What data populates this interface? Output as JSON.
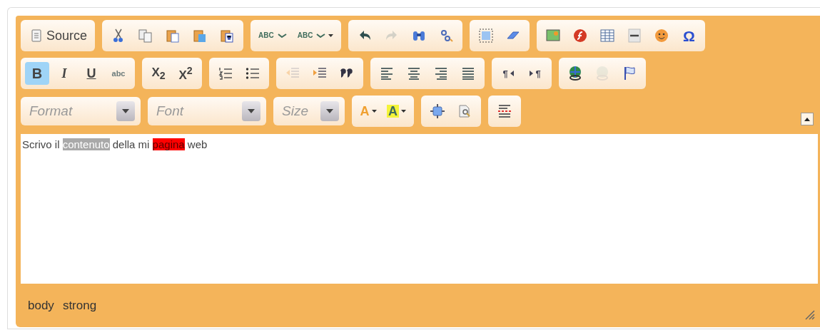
{
  "toolbar": {
    "rows": [
      {
        "combos": [],
        "groups": [
          [
            {
              "kind": "source",
              "label": "Source",
              "selected": false,
              "disabled": false
            }
          ],
          [
            {
              "kind": "cut",
              "selected": false,
              "disabled": false
            },
            {
              "kind": "copy",
              "selected": false,
              "disabled": false
            },
            {
              "kind": "paste",
              "selected": false,
              "disabled": false
            },
            {
              "kind": "pastetext",
              "selected": false,
              "disabled": false
            },
            {
              "kind": "pasteword",
              "selected": false,
              "disabled": false
            }
          ],
          [
            {
              "kind": "spell",
              "label": "ABC",
              "selected": false,
              "disabled": false
            },
            {
              "kind": "spellmenu",
              "label": "ABC",
              "selected": false,
              "disabled": false
            }
          ],
          [
            {
              "kind": "undo",
              "selected": false,
              "disabled": false
            },
            {
              "kind": "redo",
              "selected": false,
              "disabled": true
            },
            {
              "kind": "find",
              "selected": false,
              "disabled": false
            },
            {
              "kind": "replace",
              "selected": false,
              "disabled": false
            }
          ],
          [
            {
              "kind": "selectall",
              "selected": false,
              "disabled": false
            },
            {
              "kind": "eraser",
              "selected": false,
              "disabled": false
            }
          ],
          [
            {
              "kind": "image",
              "selected": false,
              "disabled": false
            },
            {
              "kind": "flash",
              "selected": false,
              "disabled": false
            },
            {
              "kind": "table",
              "selected": false,
              "disabled": false
            },
            {
              "kind": "hr",
              "selected": false,
              "disabled": false
            },
            {
              "kind": "smiley",
              "selected": false,
              "disabled": false
            },
            {
              "kind": "char",
              "label": "Ω",
              "selected": false,
              "disabled": false
            }
          ]
        ]
      },
      {
        "combos": [],
        "groups": [
          [
            {
              "kind": "bold",
              "label": "B",
              "selected": true,
              "disabled": false
            },
            {
              "kind": "italic",
              "label": "I",
              "selected": false,
              "disabled": false
            },
            {
              "kind": "underline",
              "label": "U",
              "selected": false,
              "disabled": false
            },
            {
              "kind": "strike",
              "label": "abc",
              "selected": false,
              "disabled": false
            }
          ],
          [
            {
              "kind": "script",
              "label": "X$_{2}$",
              "selected": false,
              "disabled": false
            },
            {
              "kind": "script",
              "label": "X$^{2}$",
              "selected": false,
              "disabled": false
            }
          ],
          [
            {
              "kind": "numlist",
              "selected": false,
              "disabled": false
            },
            {
              "kind": "bullist",
              "selected": false,
              "disabled": false
            }
          ],
          [
            {
              "kind": "outdent",
              "selected": false,
              "disabled": true
            },
            {
              "kind": "indent",
              "selected": false,
              "disabled": false
            },
            {
              "kind": "quote",
              "selected": false,
              "disabled": false
            }
          ],
          [
            {
              "kind": "alignleft",
              "selected": false,
              "disabled": false
            },
            {
              "kind": "aligncenter",
              "selected": false,
              "disabled": false
            },
            {
              "kind": "alignright",
              "selected": false,
              "disabled": false
            },
            {
              "kind": "justify",
              "selected": false,
              "disabled": false
            }
          ],
          [
            {
              "kind": "ltr",
              "label": "¶",
              "selected": false,
              "disabled": false
            },
            {
              "kind": "rtl",
              "label": "¶",
              "selected": false,
              "disabled": false
            }
          ],
          [
            {
              "kind": "link",
              "selected": false,
              "disabled": false
            },
            {
              "kind": "unlink",
              "selected": false,
              "disabled": true
            },
            {
              "kind": "anchor",
              "selected": false,
              "disabled": false
            }
          ]
        ]
      },
      {
        "combos": [
          {
            "label": "Format"
          },
          {
            "label": "Font"
          },
          {
            "label": "Size"
          }
        ],
        "groups": [
          [
            {
              "kind": "textcolor",
              "label": "A",
              "selected": false,
              "disabled": false
            },
            {
              "kind": "bgcolor",
              "label": "A",
              "selected": false,
              "disabled": false
            }
          ],
          [
            {
              "kind": "maximize",
              "selected": false,
              "disabled": false
            },
            {
              "kind": "showblocks",
              "selected": false,
              "disabled": false
            }
          ],
          [
            {
              "kind": "pagebreak",
              "selected": false,
              "disabled": false
            }
          ]
        ]
      }
    ]
  },
  "content": [
    {
      "text": "Scrivo il "
    },
    {
      "text": "contenuto",
      "color": "#a9a9a9"
    },
    {
      "text": " della mi "
    },
    {
      "text": "pagina",
      "color": "#ff0000"
    },
    {
      "text": " web"
    }
  ],
  "status_bar": {
    "path": [
      "body",
      "strong"
    ]
  }
}
